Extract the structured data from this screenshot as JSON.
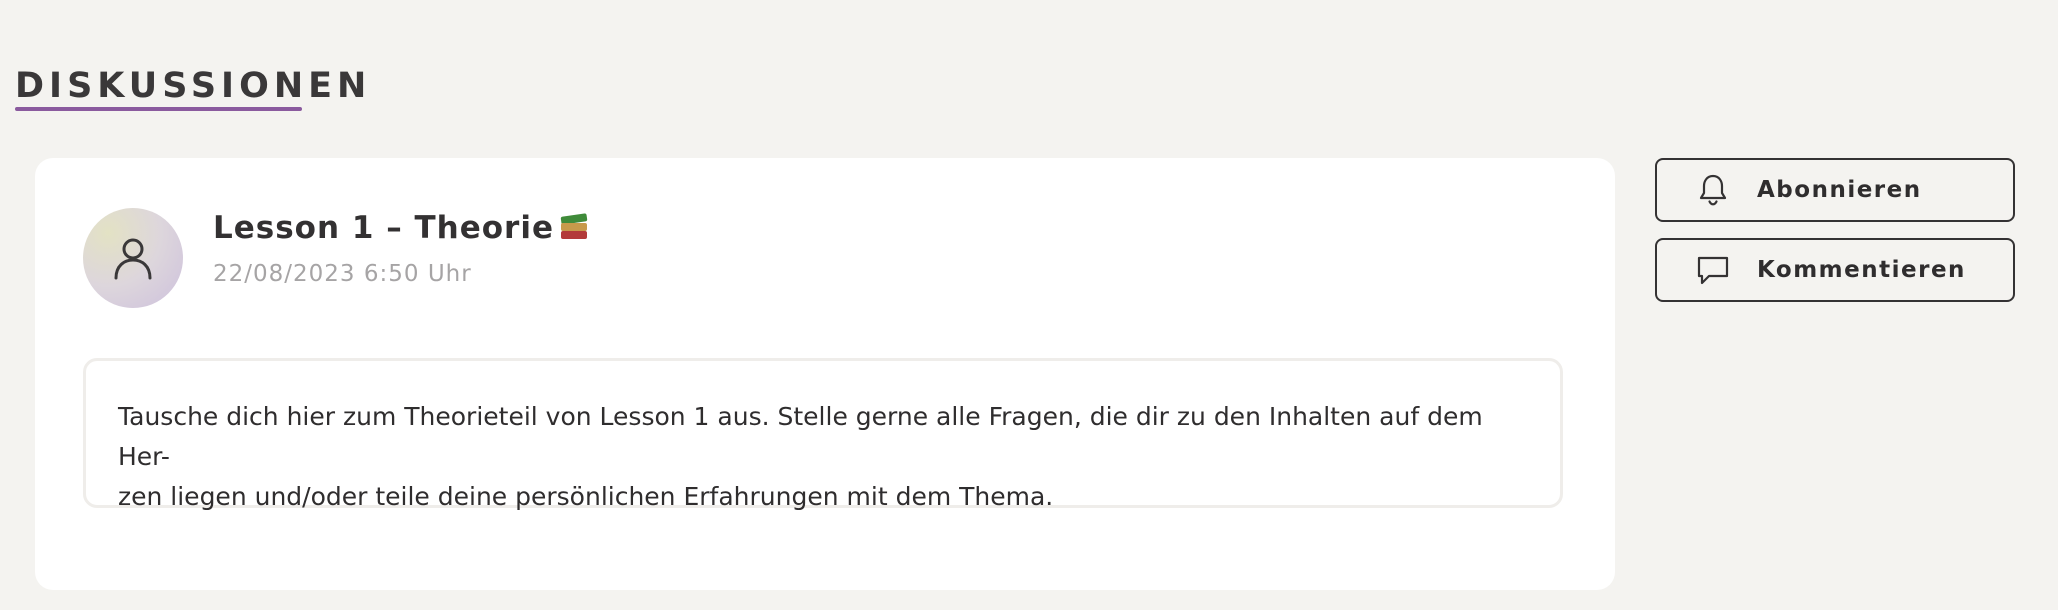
{
  "section": {
    "heading": "DISKUSSIONEN"
  },
  "post": {
    "title": "Lesson 1 – Theorie",
    "title_emoji_icon": "books-icon",
    "date": "22/08/2023 6:50 Uhr",
    "body_line_1": "Tausche dich hier zum Theorieteil von Lesson 1 aus. Stelle gerne alle Fragen, die dir zu den Inhalten auf dem Her-",
    "body_line_2": "zen liegen und/oder teile deine persönlichen Erfahrungen mit dem Thema.",
    "avatar_icon": "user-icon"
  },
  "actions": {
    "subscribe_label": "Abonnieren",
    "subscribe_icon": "bell-icon",
    "comment_label": "Kommentieren",
    "comment_icon": "speech-bubble-icon"
  },
  "colors": {
    "accent_underline": "#8a5a9e",
    "page_background": "#f4f3f0",
    "card_background": "#ffffff"
  }
}
